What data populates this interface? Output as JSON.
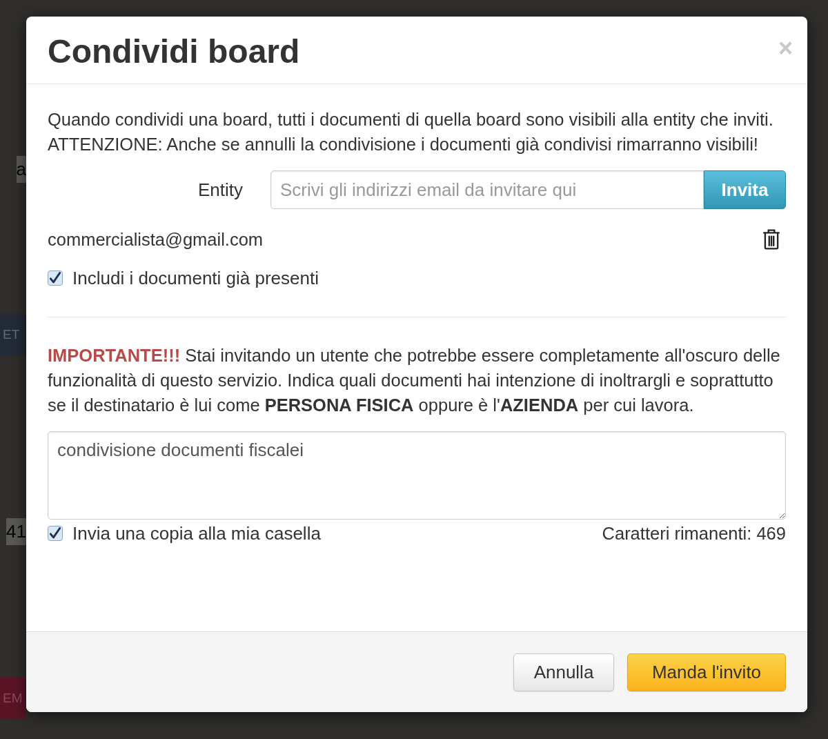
{
  "background": {
    "fragments": [
      {
        "text": "a",
        "kind": "text"
      },
      {
        "text": "ET",
        "kind": "dark_button"
      },
      {
        "text": "41",
        "kind": "text"
      },
      {
        "text": "EM",
        "kind": "red_button"
      }
    ]
  },
  "dialog": {
    "title": "Condividi board",
    "close": "×",
    "intro": "Quando condividi una board, tutti i documenti di quella board sono visibili alla entity che inviti. ATTENZIONE: Anche se annulli la condivisione i documenti già condivisi rimarranno visibili!",
    "entity_label": "Entity",
    "entity_field": {
      "placeholder": "Scrivi gli indirizzi email da invitare qui"
    },
    "invite_button": "Invita",
    "invitees": [
      {
        "email": "commercialista@gmail.com"
      }
    ],
    "include_existing": {
      "label": "Includi i documenti già presenti",
      "checked": true
    },
    "warning_lead": "IMPORTANTE!!!",
    "warning": "Stai invitando un utente che potrebbe essere completamente all'oscuro delle funzionalità di questo servizio. Indica quali documenti hai intenzione di inoltrargli e soprattutto se il destinatario è lui come **PERSONA FISICA** oppure è l'**AZIENDA** per cui lavora.",
    "message": {
      "value": "condivisione documenti fiscalei"
    },
    "send_copy": {
      "label": "Invia una copia alla mia casella",
      "checked": true
    },
    "remaining": "Caratteri rimanenti: 469",
    "buttons": [
      {
        "label": "Annulla",
        "kind": "secondary"
      },
      {
        "label": "Manda l'invito",
        "kind": "primary"
      }
    ]
  }
}
